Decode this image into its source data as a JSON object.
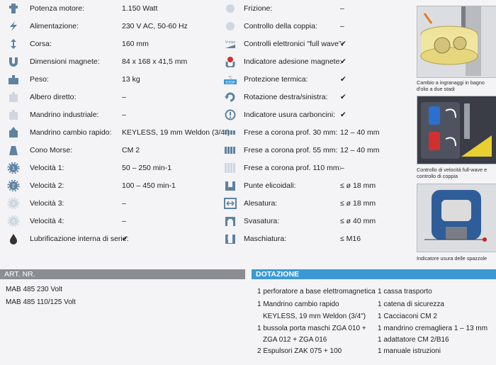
{
  "colors": {
    "icon": "#5f82a0",
    "accent": "#3c98d4",
    "band_grey": "#8c8d92",
    "check": "#222222"
  },
  "left_specs": [
    {
      "label": "Potenza motore:",
      "value": "1.150 Watt",
      "icon": "motor-icon"
    },
    {
      "label": "Alimentazione:",
      "value": "230 V AC, 50-60 Hz",
      "icon": "lightning-icon"
    },
    {
      "label": "Corsa:",
      "value": "160 mm",
      "icon": "stroke-arrow-icon"
    },
    {
      "label": "Dimensioni magnete:",
      "value": "84 x 168 x 41,5 mm",
      "icon": "magnet-icon"
    },
    {
      "label": "Peso:",
      "value": "13 kg",
      "icon": "weight-icon"
    },
    {
      "label": "Albero diretto:",
      "value": "–",
      "icon": "direct-shaft-icon"
    },
    {
      "label": "Mandrino industriale:",
      "value": "–",
      "icon": "industrial-chuck-icon"
    },
    {
      "label": "Mandrino cambio rapido:",
      "value": "KEYLESS, 19 mm Weldon (3/4\")",
      "icon": "quick-change-chuck-icon"
    },
    {
      "label": "Cono Morse:",
      "value": "CM 2",
      "icon": "morse-taper-icon"
    },
    {
      "label": "Velocità 1:",
      "value": "50 – 250 min-1",
      "icon": "gear-speed-1-icon"
    },
    {
      "label": "Velocità 2:",
      "value": "100 – 450 min-1",
      "icon": "gear-speed-2-icon"
    },
    {
      "label": "Velocità 3:",
      "value": "–",
      "icon": "gear-speed-3-icon"
    },
    {
      "label": "Velocità 4:",
      "value": "–",
      "icon": "gear-speed-4-icon"
    },
    {
      "label": "Lubrificazione interna di serie:",
      "value": "✔",
      "icon": "oil-drop-icon"
    }
  ],
  "right_specs": [
    {
      "label": "Frizione:",
      "value": "–",
      "icon": "clutch-icon"
    },
    {
      "label": "Controllo della coppia:",
      "value": "–",
      "icon": "torque-icon"
    },
    {
      "label": "Controlli elettronici \"full wave\":",
      "value": "✔",
      "icon": "v-max-icon",
      "icon_text": "V-max"
    },
    {
      "label": "Indicatore adesione magnete:",
      "value": "✔",
      "icon": "magnet-adhesion-icon"
    },
    {
      "label": "Protezione termica:",
      "value": "✔",
      "icon": "thermal-stop-icon",
      "icon_text": "°C STOP"
    },
    {
      "label": "Rotazione destra/sinistra:",
      "value": "✔",
      "icon": "rotation-icon"
    },
    {
      "label": "Indicatore usura carboncini:",
      "value": "✔",
      "icon": "brush-wear-icon"
    },
    {
      "label": "Frese a corona prof. 30 mm:",
      "value": "12 – 40 mm",
      "icon": "annular-cutter-30-icon"
    },
    {
      "label": "Frese a corona prof. 55 mm:",
      "value": "12 – 40 mm",
      "icon": "annular-cutter-55-icon"
    },
    {
      "label": "Frese a corona prof. 110 mm:",
      "value": "–",
      "icon": "annular-cutter-110-icon"
    },
    {
      "label": "Punte elicoidali:",
      "value": "≤ ø 18 mm",
      "icon": "twist-drill-icon"
    },
    {
      "label": "Alesatura:",
      "value": "≤ ø 18 mm",
      "icon": "reaming-icon"
    },
    {
      "label": "Svasatura:",
      "value": "≤ ø 40 mm",
      "icon": "countersink-icon"
    },
    {
      "label": "Maschiatura:",
      "value": "≤ M16",
      "icon": "tapping-icon"
    }
  ],
  "side_captions": [
    "Cambio a ingranaggi in bagno d'olio a due stadi",
    "Controllo di velocità full-wave e controllo di coppia",
    "Indicatore usura delle spazzole"
  ],
  "art_nr": {
    "header": "ART. NR.",
    "items": [
      "MAB 485 230 Volt",
      "MAB 485 110/125 Volt"
    ]
  },
  "dotazione": {
    "header": "DOTAZIONE",
    "col1": [
      "1 perforatore a base elettromagnetica",
      "1 Mandrino cambio rapido",
      "KEYLESS, 19 mm Weldon (3/4\")",
      "1 bussola porta maschi ZGA 010 +",
      "ZGA 012 + ZGA 016",
      "2 Espulsori ZAK 075 + 100"
    ],
    "col2": [
      "1 cassa trasporto",
      "1 catena di sicurezza",
      "1 Cacciaconi CM 2",
      "1 mandrino cremagliera 1 – 13 mm",
      "1 adattatore CM 2/B16",
      "1 manuale istruzioni"
    ]
  }
}
